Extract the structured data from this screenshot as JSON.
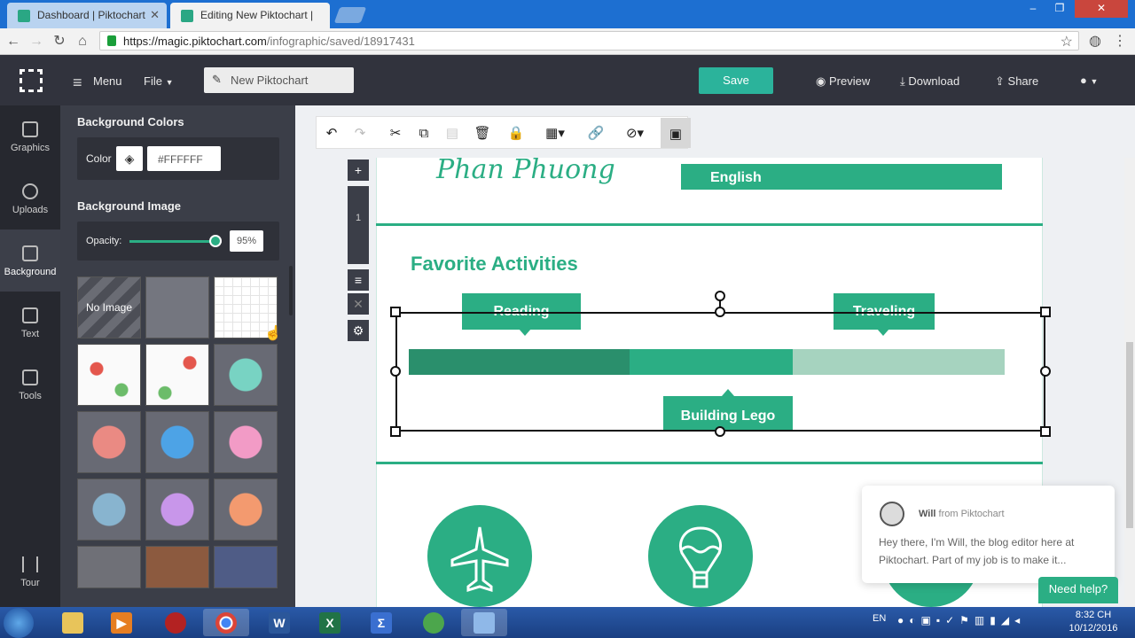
{
  "browser": {
    "tabs": [
      {
        "label": "Dashboard | Piktochart",
        "active": false
      },
      {
        "label": "Editing New Piktochart | ",
        "active": true
      }
    ],
    "url_domain": "https://magic.piktochart.com",
    "url_path": "/infographic/saved/18917431"
  },
  "header": {
    "menu_label": "Menu",
    "file_label": "File",
    "title": "New Piktochart",
    "save_label": "Save",
    "preview_label": "Preview",
    "download_label": "Download",
    "share_label": "Share"
  },
  "rail": {
    "items": [
      {
        "label": "Graphics",
        "icon": "image-icon"
      },
      {
        "label": "Uploads",
        "icon": "cloud-upload-icon"
      },
      {
        "label": "Background",
        "icon": "background-icon"
      },
      {
        "label": "Text",
        "icon": "text-icon"
      },
      {
        "label": "Tools",
        "icon": "toolbox-icon"
      }
    ],
    "tour_label": "Tour"
  },
  "panel": {
    "bg_colors_title": "Background Colors",
    "color_label": "Color",
    "color_value": "#FFFFFF",
    "bg_image_title": "Background Image",
    "opacity_label": "Opacity:",
    "opacity_value": "95%",
    "opacity_fraction": 0.95,
    "no_image_label": "No Image"
  },
  "canvas": {
    "name_text": "Phan Phuong",
    "english_label": "English",
    "section_title": "Favorite Activities",
    "bubble_reading": "Reading",
    "bubble_traveling": "Traveling",
    "bubble_lego": "Building Lego",
    "bar_segments": [
      0.37,
      0.275,
      0.355
    ],
    "colors": {
      "green": "#2bae84",
      "dark_green": "#2a8f6c",
      "light_green": "#a6d3bf"
    }
  },
  "chat": {
    "sender_name": "Will",
    "sender_from": "from Piktochart",
    "message": "Hey there, I'm Will, the blog editor here at Piktochart. Part of my job is to make it...",
    "help_label": "Need help?"
  },
  "taskbar": {
    "lang": "EN",
    "time": "8:32 CH",
    "date": "10/12/2016"
  }
}
